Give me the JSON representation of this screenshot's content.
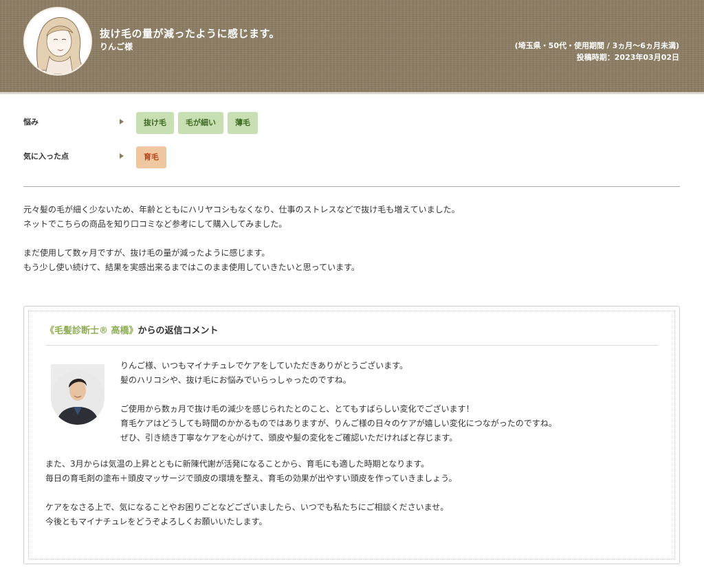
{
  "header": {
    "title": "抜け毛の量が減ったように感じます。",
    "reviewer": "りんご様",
    "meta_profile": "(埼玉県・50代・使用期間 / 3ヵ月〜6ヵ月未満)",
    "meta_date": "投稿時期：2023年03月02日"
  },
  "concerns": {
    "label": "悩み",
    "tags": [
      "抜け毛",
      "毛が細い",
      "薄毛"
    ]
  },
  "liked": {
    "label": "気に入った点",
    "tags": [
      "育毛"
    ]
  },
  "review": {
    "paragraphs": [
      [
        "元々髪の毛が細く少ないため、年齢とともにハリヤコシもなくなり、仕事のストレスなどで抜け毛も増えていました。",
        "ネットでこちらの商品を知り口コミなど参考にして購入してみました。"
      ],
      [
        "まだ使用して数ヶ月ですが、抜け毛の量が減ったように感じます。",
        "もう少し使い続けて、結果を実感出来るまではこのまま使用していきたいと思っています。"
      ]
    ]
  },
  "reply": {
    "doctor_name": "《毛髪診断士® 高橋》",
    "heading_suffix": "からの返信コメント",
    "intro": [
      [
        "りんご様、いつもマイナチュレでケアをしていただきありがとうございます。",
        "髪のハリコシや、抜け毛にお悩みでいらっしゃったのですね。"
      ],
      [
        "ご使用から数ヵ月で抜け毛の減少を感じられたとのこと、とてもすばらしい変化でございます！",
        "育毛ケアはどうしても時間のかかるものではありますが、りんご様の日々のケアが嬉しい変化につながったのですね。",
        "ぜひ、引き続き丁寧なケアを心がけて、頭皮や髪の変化をご確認いただければと存じます。"
      ]
    ],
    "rest": [
      [
        "また、3月からは気温の上昇とともに新陳代謝が活発になることから、育毛にも適した時期となります。",
        "毎日の育毛剤の塗布＋頭皮マッサージで頭皮の環境を整え、育毛の効果が出やすい頭皮を作っていきましょう。"
      ],
      [
        "ケアをなさる上で、気になることやお困りごとなどございましたら、いつでも私たちにご相談くださいませ。",
        "今後ともマイナチュレをどうぞよろしくお願いいたします。"
      ]
    ]
  },
  "colors": {
    "header_bg": "#8b7c62",
    "tag_green_bg": "#c7dfb3",
    "tag_orange_bg": "#efc7a0",
    "doctor_name": "#8fae55"
  }
}
